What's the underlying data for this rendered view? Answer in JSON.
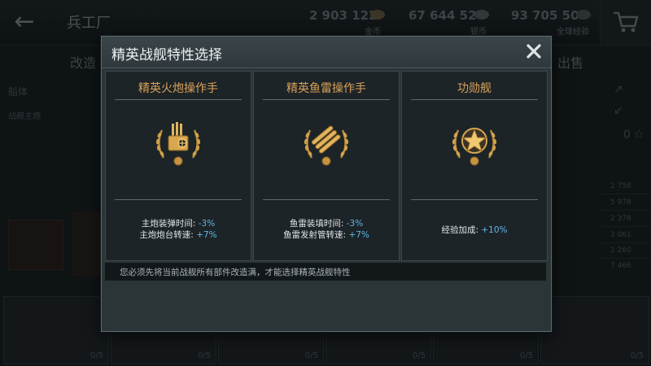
{
  "background": {
    "screen_title": "兵工厂",
    "currencies": [
      {
        "amount": "2 903 122",
        "label": "金币"
      },
      {
        "amount": "67 644 524",
        "label": "银币"
      },
      {
        "amount": "93 705 505",
        "label": "全球经验"
      }
    ],
    "tab_left": "改造",
    "tab_right": "出售",
    "side_labels": [
      "船体",
      "战舰主炮"
    ],
    "stat_values": [
      "1 758",
      "5 978",
      "2 378",
      "3 061",
      "1 260",
      "7 466"
    ],
    "star_count": "0",
    "slot_count": "0/5"
  },
  "modal": {
    "title": "精英战舰特性选择",
    "panels": [
      {
        "title": "精英火炮操作手",
        "icon": "turret-emblem-icon",
        "stats": [
          {
            "label": "主炮装弹时间:",
            "value": "-3%"
          },
          {
            "label": "主炮炮台转速:",
            "value": "+7%"
          }
        ]
      },
      {
        "title": "精英鱼雷操作手",
        "icon": "torpedo-emblem-icon",
        "stats": [
          {
            "label": "鱼雷装填时间:",
            "value": "-3%"
          },
          {
            "label": "鱼雷发射管转速:",
            "value": "+7%"
          }
        ]
      },
      {
        "title": "功勋舰",
        "icon": "star-emblem-icon",
        "stats": [
          {
            "label": "经验加成:",
            "value": "+10%"
          }
        ]
      }
    ],
    "notice": "您必须先将当前战舰所有部件改造满，才能选择精英战舰特性"
  },
  "colors": {
    "accent_gold": "#d9a25a",
    "value_blue": "#5fb6e6",
    "modal_bg": "#2b3437"
  }
}
